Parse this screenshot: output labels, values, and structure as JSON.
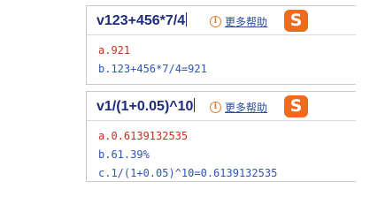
{
  "suggestions": [
    {
      "query": "v123+456*7/4",
      "help_label": "更多帮助",
      "info_glyph": "i",
      "logo_glyph": "S",
      "results": [
        {
          "prefix": "a.",
          "text": "921"
        },
        {
          "prefix": "b.",
          "text": "123+456*7/4=921"
        }
      ]
    },
    {
      "query": "v1/(1+0.05)^10",
      "help_label": "更多帮助",
      "info_glyph": "i",
      "logo_glyph": "S",
      "results": [
        {
          "prefix": "a.",
          "text": "0.6139132535"
        },
        {
          "prefix": "b.",
          "text": "61.39%"
        },
        {
          "prefix": "c.",
          "text": "1/(1+0.05)^10=0.6139132535"
        }
      ]
    }
  ],
  "colors": {
    "query_text": "#1d2d7a",
    "help_link": "#2b4ea1",
    "first_result": "#c8301c",
    "other_result": "#2c56b8",
    "logo_background": "#ee6a1c",
    "info_icon": "#e07c2a"
  }
}
